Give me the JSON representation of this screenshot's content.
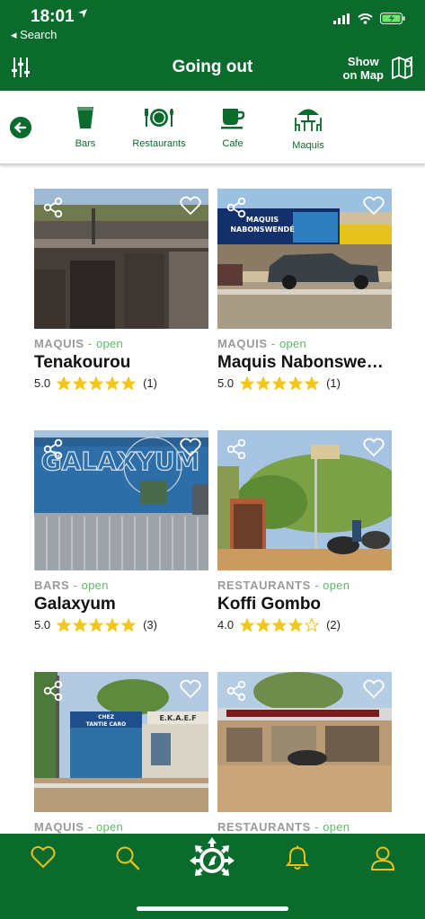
{
  "status_bar": {
    "time": "18:01",
    "back_label": "◂ Search"
  },
  "header": {
    "title": "Going out",
    "show_map_line1": "Show",
    "show_map_line2": "on Map"
  },
  "categories": [
    {
      "label": "Bars",
      "icon": "glass-icon"
    },
    {
      "label": "Restaurants",
      "icon": "plate-icon"
    },
    {
      "label": "Cafe",
      "icon": "cup-icon"
    },
    {
      "label": "Maquis",
      "icon": "table-umbrella-icon"
    }
  ],
  "listings": [
    {
      "type": "MAQUIS",
      "sep": " - ",
      "status": "open",
      "name": "Tenakourou",
      "score": "5.0",
      "stars": 5,
      "reviews": "(1)"
    },
    {
      "type": "MAQUIS",
      "sep": " - ",
      "status": "open",
      "name": "Maquis Nabonswendé",
      "score": "5.0",
      "stars": 5,
      "reviews": "(1)"
    },
    {
      "type": "BARS",
      "sep": " - ",
      "status": "open",
      "name": "Galaxyum",
      "score": "5.0",
      "stars": 5,
      "reviews": "(3)"
    },
    {
      "type": "RESTAURANTS",
      "sep": " - ",
      "status": "open",
      "name": "Koffi Gombo",
      "score": "4.0",
      "stars": 4,
      "reviews": "(2)"
    },
    {
      "type": "MAQUIS",
      "sep": " - ",
      "status": "open"
    },
    {
      "type": "RESTAURANTS",
      "sep": " - ",
      "status": "open"
    }
  ],
  "photo_signs": {
    "nabonswende_line1": "MAQUIS",
    "nabonswende_line2": "NABONSWENDÉ",
    "galaxyum": "GALAXYUM",
    "chez_line1": "CHEZ",
    "chez_line2": "TANTIE CARO",
    "ekaef": "E.K.A.E.F"
  },
  "colors": {
    "brand_green": "#0b6b2c",
    "open_green": "#5fb867",
    "star_gold": "#f5c518",
    "meta_gray": "#9a9a9a"
  },
  "bottom_nav": [
    "heart-icon",
    "search-icon",
    "compass-home-icon",
    "bell-icon",
    "user-icon"
  ]
}
